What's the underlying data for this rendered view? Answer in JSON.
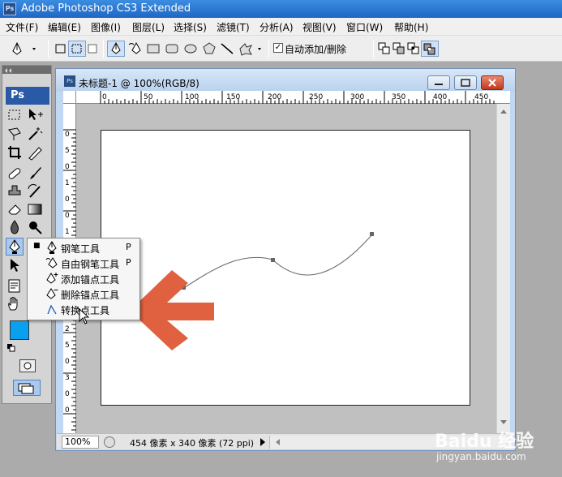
{
  "app": {
    "logo_text": "Ps",
    "title": "Adobe Photoshop CS3 Extended"
  },
  "menu": [
    "文件(F)",
    "编辑(E)",
    "图像(I)",
    "图层(L)",
    "选择(S)",
    "滤镜(T)",
    "分析(A)",
    "视图(V)",
    "窗口(W)",
    "帮助(H)"
  ],
  "options": {
    "auto_add_delete_label": "自动添加/删除",
    "auto_add_delete_checked": true
  },
  "toolbox": {
    "logo_text": "Ps"
  },
  "document": {
    "icon_text": "Ps",
    "title": "未标题-1 @ 100%(RGB/8)",
    "ruler_top": [
      "0",
      "50",
      "100",
      "150",
      "200",
      "250",
      "300",
      "350",
      "400",
      "450"
    ],
    "ruler_left": [
      "0",
      "5",
      "0",
      "1",
      "0",
      "0",
      "1",
      "5",
      "0",
      "2",
      "0",
      "0",
      "2",
      "5",
      "0",
      "3",
      "0",
      "0"
    ],
    "zoom": "100%",
    "size_info": "454 像素 x 340 像素 (72 ppi)"
  },
  "flyout": {
    "items": [
      {
        "label": "钢笔工具",
        "key": "P",
        "active": true
      },
      {
        "label": "自由钢笔工具",
        "key": "P",
        "active": false
      },
      {
        "label": "添加锚点工具",
        "key": "",
        "active": false
      },
      {
        "label": "删除锚点工具",
        "key": "",
        "active": false
      },
      {
        "label": "转换点工具",
        "key": "",
        "active": false,
        "hovered": true
      }
    ]
  },
  "colors": {
    "foreground": "#0aa0f0",
    "background": "#ffffff",
    "arrow": "#e0613f",
    "title_bar": "#1f66c5"
  },
  "watermark": {
    "brand": "Baidu 经验",
    "url": "jingyan.baidu.com"
  }
}
